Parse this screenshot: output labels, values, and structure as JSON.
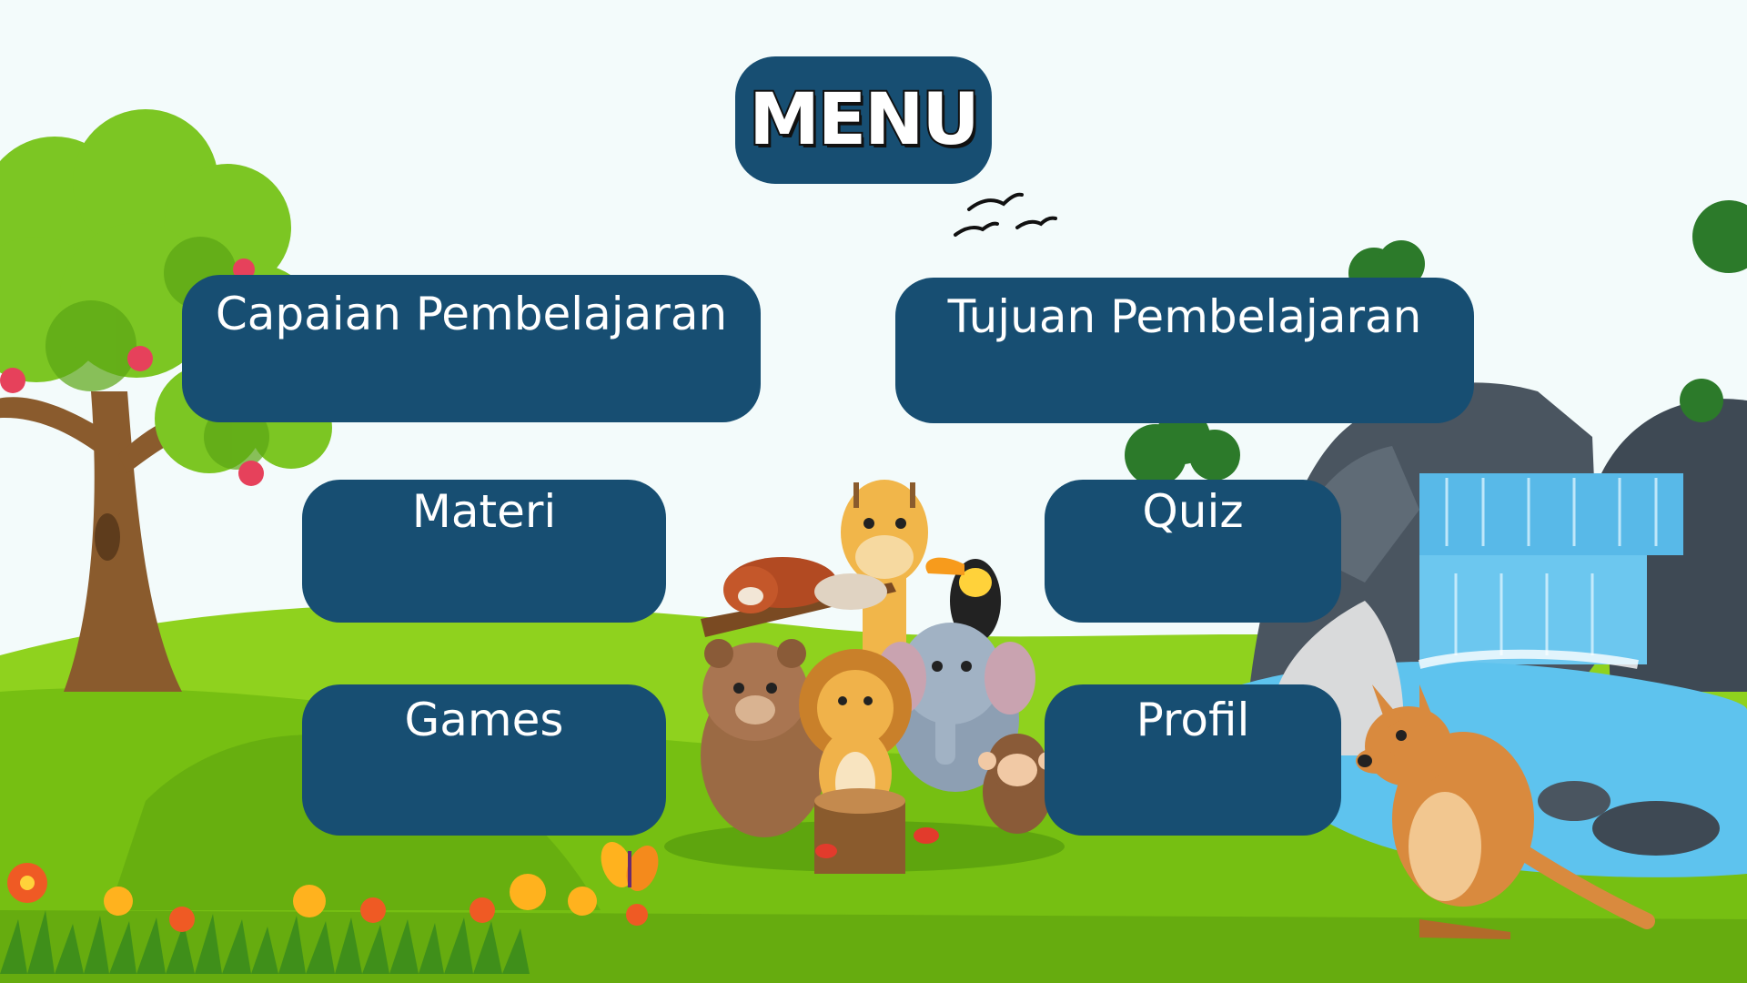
{
  "header": {
    "title": "MENU"
  },
  "menu": {
    "capaian_label": "Capaian Pembelajaran",
    "tujuan_label": "Tujuan Pembelajaran",
    "materi_label": "Materi",
    "quiz_label": "Quiz",
    "games_label": "Games",
    "profil_label": "Profil"
  },
  "colors": {
    "button_bg": "#174e72",
    "button_text": "#ffffff",
    "sky": "#f3fbfb",
    "grass": "#7cc21a",
    "water": "#5ec3ee"
  }
}
